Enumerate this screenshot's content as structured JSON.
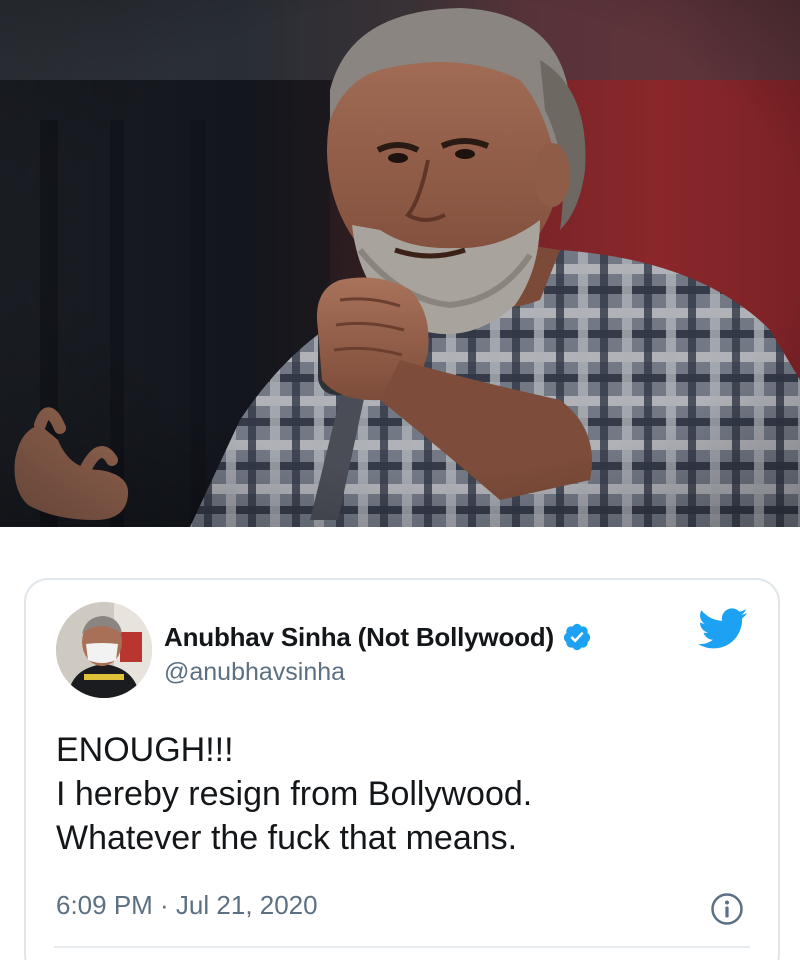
{
  "photo": {
    "subject": "speaker-holding-microphone-icon"
  },
  "tweet": {
    "display_name": "Anubhav Sinha (Not Bollywood)",
    "handle": "@anubhavsinha",
    "verified": true,
    "text": "ENOUGH!!!\nI hereby resign from Bollywood.\nWhatever the fuck that means.",
    "timestamp": "6:09 PM · Jul 21, 2020",
    "icons": {
      "verified": "verified-badge-icon",
      "brand": "twitter-bird-icon",
      "info": "info-icon"
    },
    "colors": {
      "accent": "#1da1f2",
      "text": "#14171a",
      "muted": "#5b7083",
      "border": "#dfe6ec"
    }
  }
}
